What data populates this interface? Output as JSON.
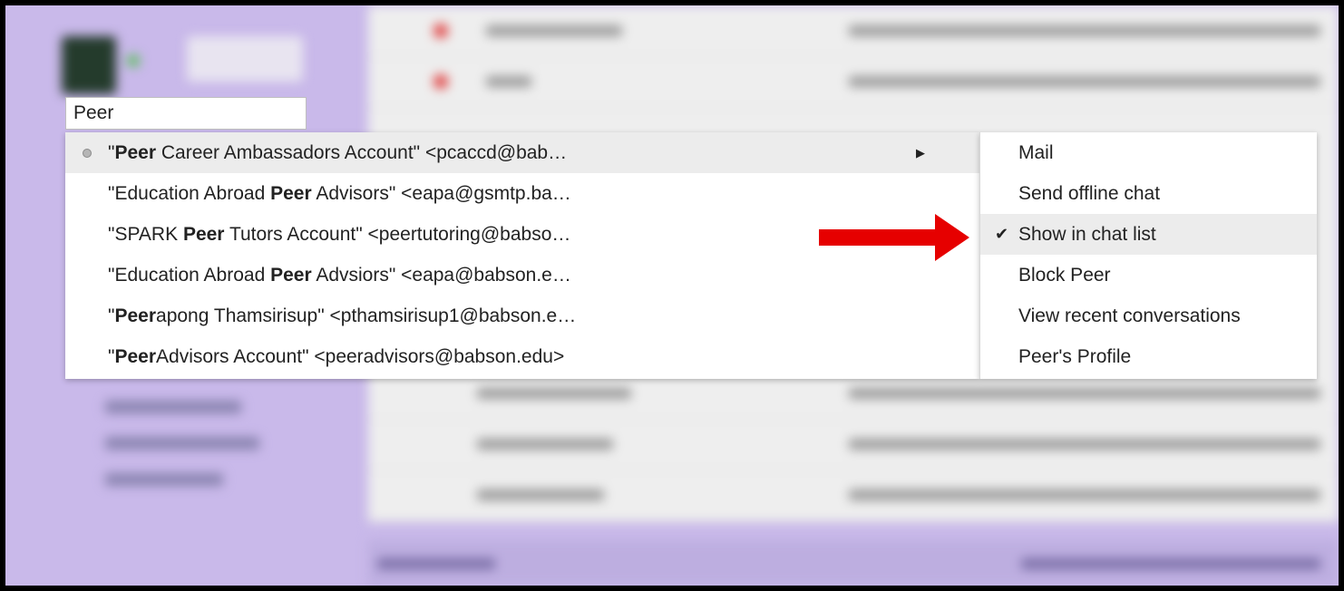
{
  "search": {
    "value": "Peer"
  },
  "suggestions": [
    {
      "pre": "\"",
      "bold": "Peer",
      "post": " Career Ambassadors Account\" <pcaccd@bab…",
      "selected": true
    },
    {
      "pre": "\"Education Abroad ",
      "bold": "Peer",
      "post": " Advisors\" <eapa@gsmtp.ba…"
    },
    {
      "pre": "\"SPARK ",
      "bold": "Peer",
      "post": " Tutors Account\" <peertutoring@babso…"
    },
    {
      "pre": "\"Education Abroad ",
      "bold": "Peer",
      "post": " Advsiors\" <eapa@babson.e…"
    },
    {
      "pre": "\"",
      "bold": "Peer",
      "post": "apong Thamsirisup\" <pthamsirisup1@babson.e…"
    },
    {
      "pre": "\"",
      "bold": "Peer",
      "post": "Advisors Account\" <peeradvisors@babson.edu>"
    }
  ],
  "context_menu": {
    "items": [
      {
        "label": "Mail"
      },
      {
        "label": "Send offline chat"
      },
      {
        "label": "Show in chat list",
        "checked": true
      },
      {
        "label": "Block Peer"
      },
      {
        "label": "View recent conversations"
      },
      {
        "label": "Peer's Profile"
      }
    ]
  },
  "icons": {
    "submenu_arrow": "triangle-right-icon",
    "check": "checkmark-icon",
    "pointer": "red-arrow-icon",
    "status": "status-dot-icon"
  },
  "colors": {
    "background": "#c9b9ea",
    "highlight": "#ececec",
    "arrow": "#e60000"
  }
}
